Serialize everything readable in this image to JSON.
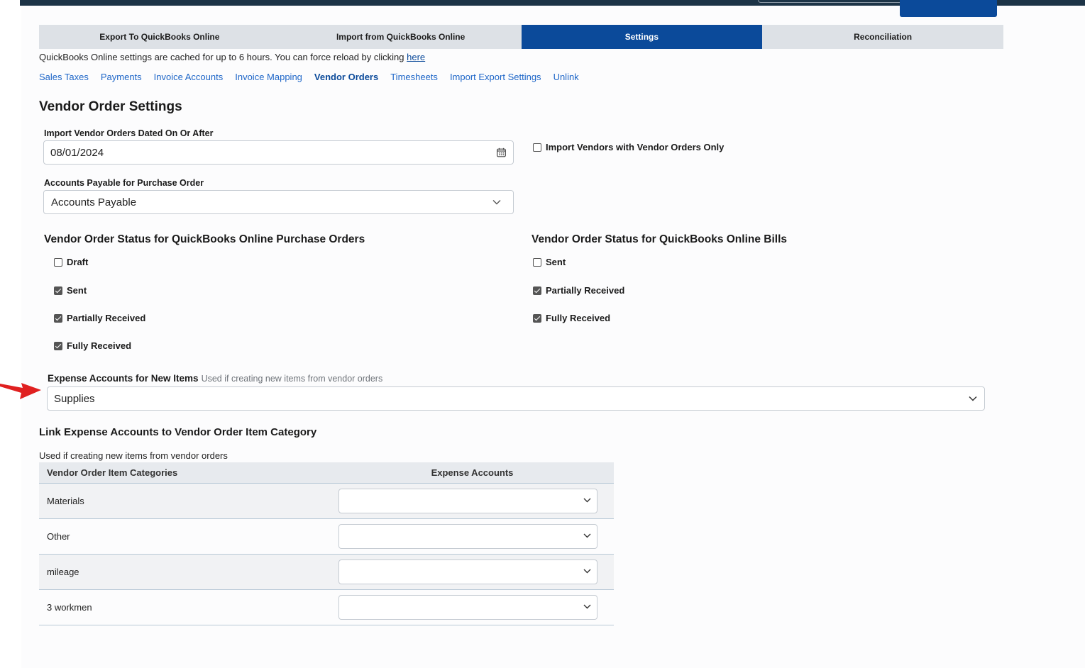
{
  "tabs": [
    {
      "label": "Export To QuickBooks Online"
    },
    {
      "label": "Import from QuickBooks Online"
    },
    {
      "label": "Settings"
    },
    {
      "label": "Reconciliation"
    }
  ],
  "cache_note": {
    "text": "QuickBooks Online settings are cached for up to 6 hours. You can force reload by clicking ",
    "link": "here"
  },
  "subnav": [
    {
      "label": "Sales Taxes"
    },
    {
      "label": "Payments"
    },
    {
      "label": "Invoice Accounts"
    },
    {
      "label": "Invoice Mapping"
    },
    {
      "label": "Vendor Orders"
    },
    {
      "label": "Timesheets"
    },
    {
      "label": "Import Export Settings"
    },
    {
      "label": "Unlink"
    }
  ],
  "page_title": "Vendor Order Settings",
  "import_date": {
    "label": "Import Vendor Orders Dated On Or After",
    "value": "08/01/2024",
    "icon": "calendar-icon"
  },
  "vendors_only": {
    "label": "Import Vendors with Vendor Orders Only",
    "checked": false
  },
  "accounts_payable": {
    "label": "Accounts Payable for Purchase Order",
    "value": "Accounts Payable"
  },
  "po_status": {
    "heading": "Vendor Order Status for QuickBooks Online Purchase Orders",
    "items": [
      {
        "label": "Draft",
        "checked": false
      },
      {
        "label": "Sent",
        "checked": true
      },
      {
        "label": "Partially Received",
        "checked": true
      },
      {
        "label": "Fully Received",
        "checked": true
      }
    ]
  },
  "bill_status": {
    "heading": "Vendor Order Status for QuickBooks Online Bills",
    "items": [
      {
        "label": "Sent",
        "checked": false
      },
      {
        "label": "Partially Received",
        "checked": true
      },
      {
        "label": "Fully Received",
        "checked": true
      }
    ]
  },
  "expense_accounts": {
    "label": "Expense Accounts for New Items",
    "hint": "Used if creating new items from vendor orders",
    "value": "Supplies"
  },
  "link_section": {
    "heading": "Link Expense Accounts to Vendor Order Item Category",
    "subtext": "Used if creating new items from vendor orders",
    "columns": [
      "Vendor Order Item Categories",
      "Expense Accounts"
    ],
    "rows": [
      {
        "category": "Materials",
        "account": ""
      },
      {
        "category": "Other",
        "account": ""
      },
      {
        "category": "mileage",
        "account": ""
      },
      {
        "category": "3 workmen",
        "account": ""
      }
    ]
  },
  "colors": {
    "primary": "#0b4a9a",
    "link": "#1e66c8",
    "tab_bg": "#dde1e6",
    "arrow": "#e02020"
  }
}
